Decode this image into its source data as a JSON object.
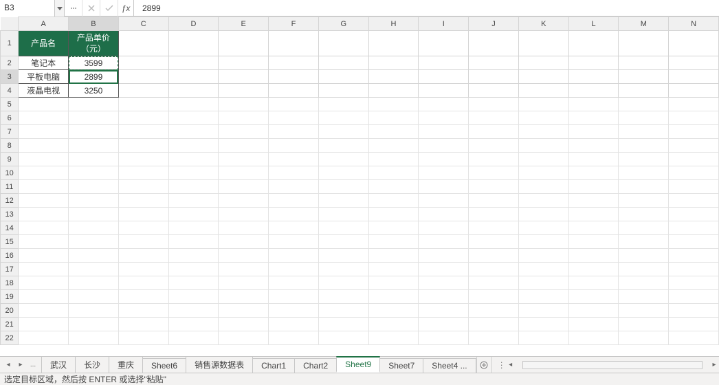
{
  "formula_bar": {
    "name_box": "B3",
    "formula_value": "2899"
  },
  "columns": [
    "A",
    "B",
    "C",
    "D",
    "E",
    "F",
    "G",
    "H",
    "I",
    "J",
    "K",
    "L",
    "M",
    "N"
  ],
  "row_count": 22,
  "header_cells": {
    "A1": "产品名",
    "B1": "产品单价（元）"
  },
  "data_cells": {
    "A2": "笔记本",
    "B2": "3599",
    "A3": "平板电脑",
    "B3": "2899",
    "A4": "液晶电视",
    "B4": "3250"
  },
  "active_cell": "B3",
  "tabs": {
    "items": [
      "武汉",
      "长沙",
      "重庆",
      "Sheet6",
      "销售源数据表",
      "Chart1",
      "Chart2",
      "Sheet9",
      "Sheet7",
      "Sheet4 ..."
    ],
    "active": "Sheet9",
    "overflow_prefix": "..."
  },
  "status_bar": {
    "message": "选定目标区域，然后按 ENTER 或选择\"粘贴\""
  }
}
